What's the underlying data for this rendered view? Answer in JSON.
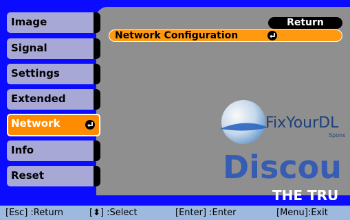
{
  "sidebar": {
    "items": [
      {
        "label": "Image"
      },
      {
        "label": "Signal"
      },
      {
        "label": "Settings"
      },
      {
        "label": "Extended"
      },
      {
        "label": "Network",
        "selected": true
      },
      {
        "label": "Info"
      },
      {
        "label": "Reset"
      }
    ]
  },
  "panel": {
    "return_label": "Return",
    "items": [
      {
        "label": "Network Configuration"
      }
    ]
  },
  "watermark": {
    "brand": "FixYourDL",
    "sub": "Spons",
    "large": "Discou",
    "bottom": "THE TRU"
  },
  "status_bar": {
    "esc": "[Esc] :Return",
    "select": "[⬍] :Select",
    "enter": "[Enter] :Enter",
    "menu": "[Menu]:Exit"
  },
  "colors": {
    "background": "#0b0bff",
    "panel": "#8f8f8f",
    "menu_item": "#a8a8d6",
    "selected": "#ff8c00",
    "status_bar": "#9eb9e0"
  },
  "icons": {
    "enter": "enter-icon"
  }
}
